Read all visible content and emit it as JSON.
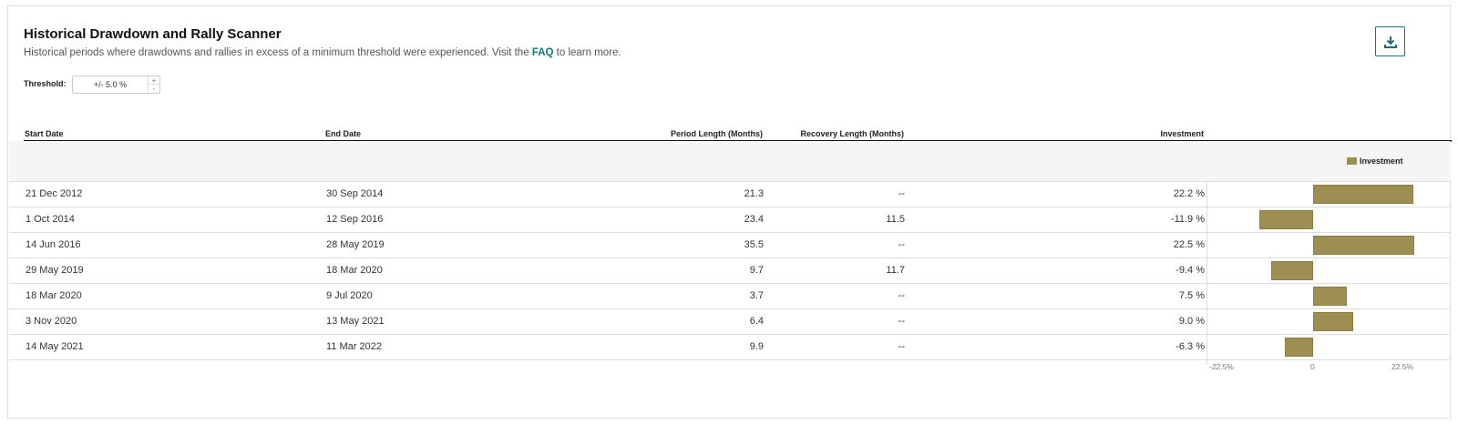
{
  "header": {
    "title": "Historical Drawdown and Rally Scanner",
    "subtitle_before": "Historical periods where drawdowns and rallies in excess of a minimum threshold were experienced. Visit the",
    "faq_link": "FAQ",
    "subtitle_after": "to learn more."
  },
  "toolbar": {
    "download_icon": "download-icon"
  },
  "threshold": {
    "label": "Threshold:",
    "value": "+/- 5.0 %",
    "increment": "+",
    "decrement": "-"
  },
  "table": {
    "columns": {
      "start": "Start Date",
      "end": "End Date",
      "period": "Period Length (Months)",
      "recovery": "Recovery Length (Months)",
      "investment": "Investment"
    },
    "legend": "Investment",
    "rows": [
      {
        "start": "21 Dec 2012",
        "end": "30 Sep 2014",
        "period": "21.3",
        "recovery": "--",
        "investment": "22.2 %",
        "value": 22.2
      },
      {
        "start": "1 Oct 2014",
        "end": "12 Sep 2016",
        "period": "23.4",
        "recovery": "11.5",
        "investment": "-11.9 %",
        "value": -11.9
      },
      {
        "start": "14 Jun 2016",
        "end": "28 May 2019",
        "period": "35.5",
        "recovery": "--",
        "investment": "22.5 %",
        "value": 22.5
      },
      {
        "start": "29 May 2019",
        "end": "18 Mar 2020",
        "period": "9.7",
        "recovery": "11.7",
        "investment": "-9.4 %",
        "value": -9.4
      },
      {
        "start": "18 Mar 2020",
        "end": "9 Jul 2020",
        "period": "3.7",
        "recovery": "--",
        "investment": "7.5 %",
        "value": 7.5
      },
      {
        "start": "3 Nov 2020",
        "end": "13 May 2021",
        "period": "6.4",
        "recovery": "--",
        "investment": "9.0 %",
        "value": 9.0
      },
      {
        "start": "14 May 2021",
        "end": "11 Mar 2022",
        "period": "9.9",
        "recovery": "--",
        "investment": "-6.3 %",
        "value": -6.3
      }
    ]
  },
  "chart_data": {
    "type": "bar",
    "orientation": "horizontal",
    "categories": [
      "21 Dec 2012",
      "1 Oct 2014",
      "14 Jun 2016",
      "29 May 2019",
      "18 Mar 2020",
      "3 Nov 2020",
      "14 May 2021"
    ],
    "series": [
      {
        "name": "Investment",
        "values": [
          22.2,
          -11.9,
          22.5,
          -9.4,
          7.5,
          9.0,
          -6.3
        ]
      }
    ],
    "xlim": [
      -22.5,
      22.5
    ],
    "tick_labels": [
      "-22.5%",
      "0",
      "22.5%"
    ],
    "legend": "top-right",
    "color": "#9d8f52"
  }
}
